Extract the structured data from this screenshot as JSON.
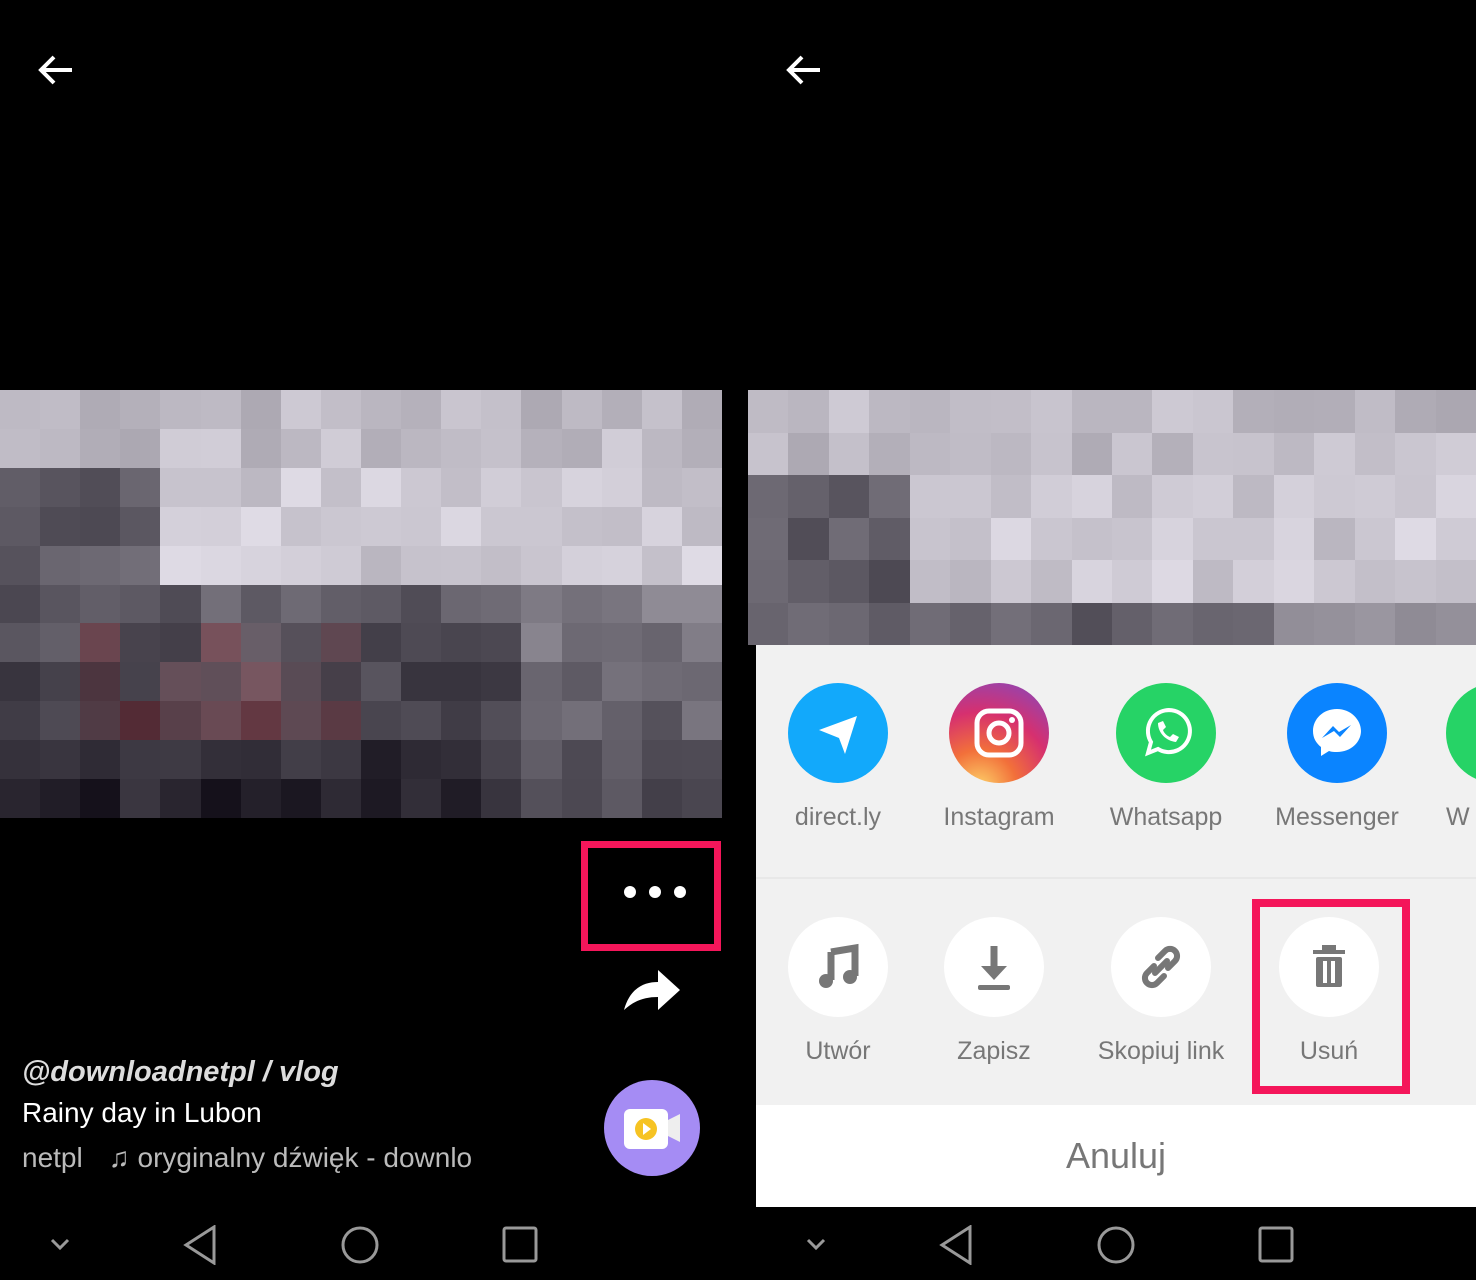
{
  "left": {
    "caption": {
      "user": "@downloadnetpl / vlog",
      "title": "Rainy day in Lubon",
      "author": "netpl",
      "sound": "oryginalny dźwięk - downlo"
    },
    "more_icon": "more-horizontal-icon",
    "highlight_color": "#f4165a"
  },
  "right": {
    "share_targets": [
      {
        "label": "direct.ly",
        "color": "#12a9fb"
      },
      {
        "label": "Instagram",
        "color": "#d6306f"
      },
      {
        "label": "Whatsapp",
        "color": "#26d366"
      },
      {
        "label": "Messenger",
        "color": "#0a84ff"
      },
      {
        "label": "W",
        "color": "#26d366"
      }
    ],
    "actions": [
      {
        "label": "Utwór",
        "icon": "music-note-icon"
      },
      {
        "label": "Zapisz",
        "icon": "download-icon"
      },
      {
        "label": "Skopiuj link",
        "icon": "link-icon"
      },
      {
        "label": "Usuń",
        "icon": "trash-icon"
      }
    ],
    "cancel_label": "Anuluj"
  }
}
